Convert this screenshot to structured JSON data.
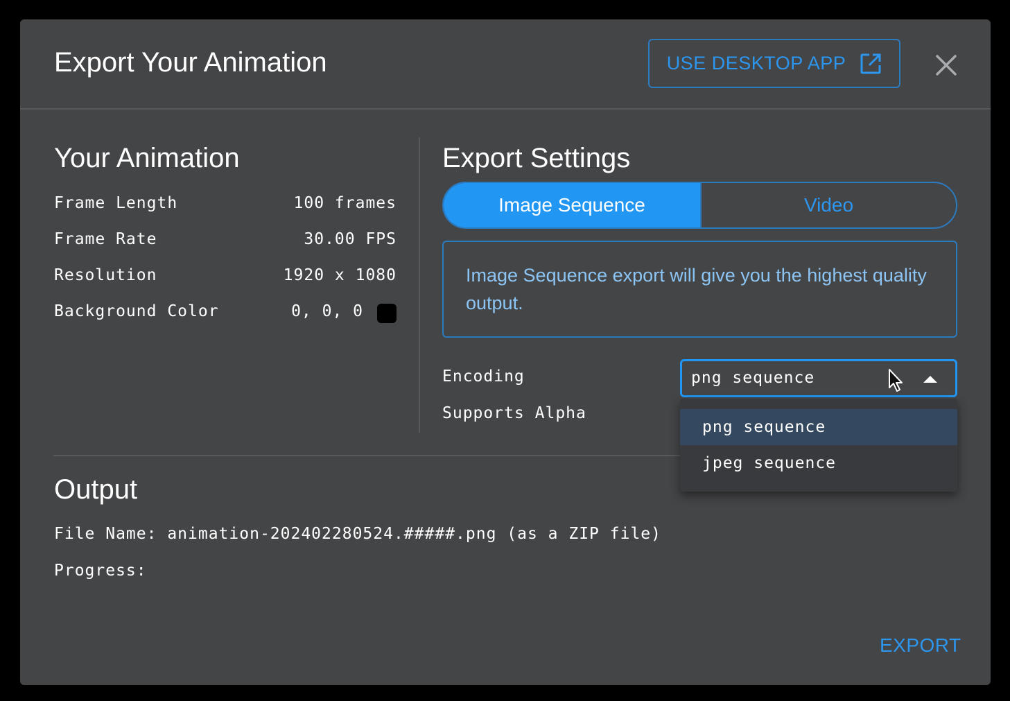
{
  "dialog": {
    "title": "Export Your Animation",
    "desktop_button_label": "USE DESKTOP APP",
    "close_icon": "close-icon",
    "external_link_icon": "external-link-icon"
  },
  "animation": {
    "title": "Your Animation",
    "rows": [
      {
        "label": "Frame Length",
        "value": "100 frames"
      },
      {
        "label": "Frame Rate",
        "value": "30.00 FPS"
      },
      {
        "label": "Resolution",
        "value": "1920 x 1080"
      },
      {
        "label": "Background Color",
        "value": "0, 0, 0",
        "swatch_color": "#000000"
      }
    ]
  },
  "export_settings": {
    "title": "Export Settings",
    "tabs": [
      {
        "label": "Image Sequence",
        "active": true
      },
      {
        "label": "Video",
        "active": false
      }
    ],
    "info_text": "Image Sequence export will give you the highest quality output.",
    "encoding_label": "Encoding",
    "encoding_value": "png sequence",
    "supports_alpha_label": "Supports Alpha",
    "encoding_options": [
      {
        "label": "png sequence",
        "selected": true
      },
      {
        "label": "jpeg sequence",
        "selected": false
      }
    ]
  },
  "output": {
    "title": "Output",
    "file_name_line": "File Name: animation-202402280524.#####.png (as a ZIP file)",
    "progress_label": "Progress:"
  },
  "footer": {
    "export_label": "EXPORT"
  },
  "colors": {
    "accent": "#2196f3",
    "dialog_bg": "#444547",
    "info_text": "#8cc5f4"
  }
}
